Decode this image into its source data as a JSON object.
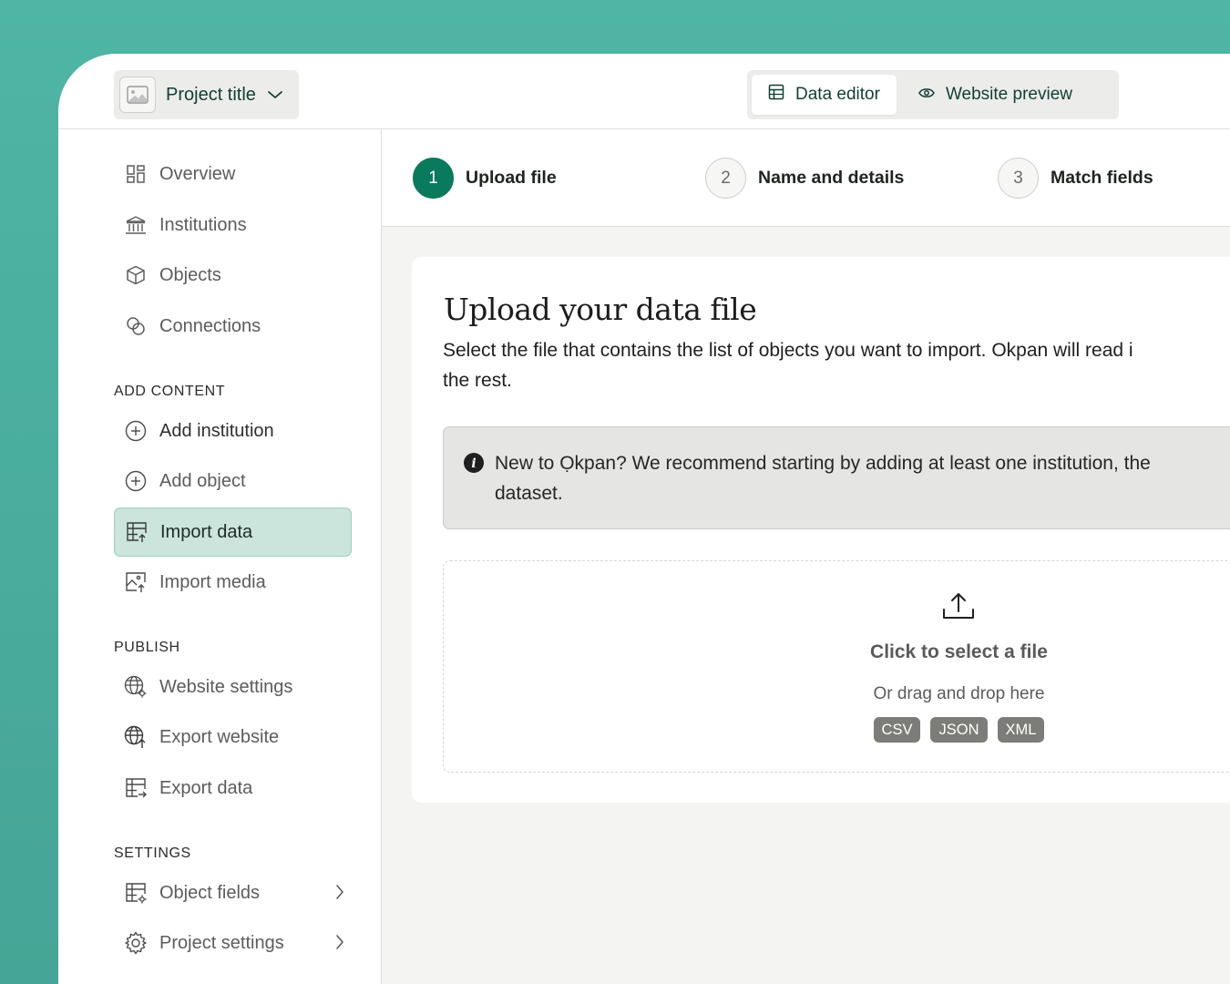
{
  "topbar": {
    "project_title": "Project title",
    "tabs": [
      {
        "label": "Data editor",
        "active": true
      },
      {
        "label": "Website preview",
        "active": false
      }
    ]
  },
  "sidebar": {
    "main_items": [
      {
        "label": "Overview",
        "icon": "grid-icon"
      },
      {
        "label": "Institutions",
        "icon": "institution-icon"
      },
      {
        "label": "Objects",
        "icon": "cube-icon"
      },
      {
        "label": "Connections",
        "icon": "connections-icon"
      }
    ],
    "sections": {
      "add_content": "ADD CONTENT",
      "publish": "PUBLISH",
      "settings": "SETTINGS"
    },
    "add_content_items": [
      {
        "label": "Add institution",
        "icon": "plus-circle-icon"
      },
      {
        "label": "Add object",
        "icon": "plus-circle-icon"
      },
      {
        "label": "Import data",
        "icon": "table-import-icon",
        "active": true
      },
      {
        "label": "Import media",
        "icon": "image-import-icon"
      }
    ],
    "publish_items": [
      {
        "label": "Website settings",
        "icon": "globe-gear-icon"
      },
      {
        "label": "Export website",
        "icon": "globe-export-icon"
      },
      {
        "label": "Export data",
        "icon": "table-export-icon"
      }
    ],
    "settings_items": [
      {
        "label": "Object fields",
        "icon": "table-gear-icon"
      },
      {
        "label": "Project settings",
        "icon": "gear-icon"
      }
    ]
  },
  "steps": [
    {
      "number": "1",
      "label": "Upload file",
      "active": true
    },
    {
      "number": "2",
      "label": "Name and details",
      "active": false
    },
    {
      "number": "3",
      "label": "Match fields",
      "active": false
    }
  ],
  "main": {
    "title": "Upload your data file",
    "description": "Select the file that contains the list of objects you want to import. Okpan will read i",
    "description_line2": "the rest.",
    "notice_line1": "New to Ọkpan? We recommend starting by adding at least one institution, the",
    "notice_line2": "dataset.",
    "dropzone": {
      "title": "Click to select a file",
      "subtitle": "Or drag and drop here",
      "formats": [
        "CSV",
        "JSON",
        "XML"
      ]
    }
  },
  "colors": {
    "background": "#4fb5a5",
    "accent": "#097a5c",
    "active_nav_bg": "#cbe5dc"
  }
}
